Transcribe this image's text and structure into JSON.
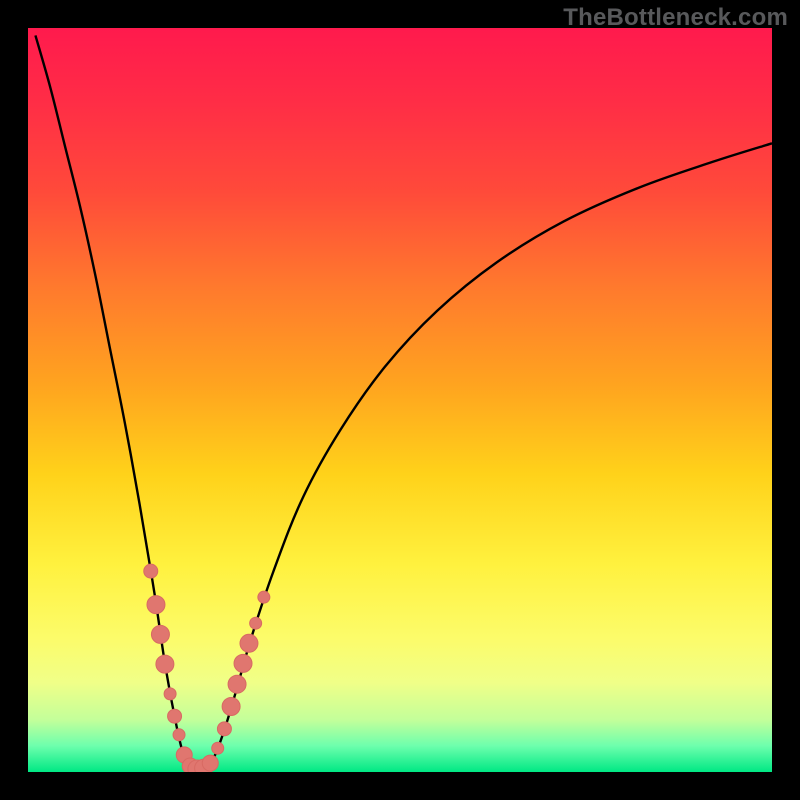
{
  "watermark": "TheBottleneck.com",
  "colors": {
    "frame": "#000000",
    "curve": "#000000",
    "marker_fill": "#e0766f",
    "marker_stroke": "#d86a63",
    "gradient_stops": [
      {
        "offset": 0.0,
        "color": "#ff1a4d"
      },
      {
        "offset": 0.1,
        "color": "#ff2d46"
      },
      {
        "offset": 0.22,
        "color": "#ff4a3a"
      },
      {
        "offset": 0.35,
        "color": "#ff7a2d"
      },
      {
        "offset": 0.48,
        "color": "#ffa41f"
      },
      {
        "offset": 0.6,
        "color": "#ffd21a"
      },
      {
        "offset": 0.72,
        "color": "#fff13e"
      },
      {
        "offset": 0.82,
        "color": "#fcfc6a"
      },
      {
        "offset": 0.88,
        "color": "#f0ff88"
      },
      {
        "offset": 0.93,
        "color": "#c3ff9a"
      },
      {
        "offset": 0.965,
        "color": "#6dffad"
      },
      {
        "offset": 1.0,
        "color": "#00e884"
      }
    ]
  },
  "chart_data": {
    "type": "line",
    "title": "",
    "xlabel": "",
    "ylabel": "",
    "xlim": [
      0,
      100
    ],
    "ylim": [
      0,
      100
    ],
    "grid": false,
    "legend": false,
    "notes": "V-shaped bottleneck curve on red→green vertical gradient. Minimum (~0) at x≈22. Curve value ≈ distance from the optimum; markers are data points clustered near the trough.",
    "curve": [
      {
        "x": 1.0,
        "y": 99.0
      },
      {
        "x": 3.0,
        "y": 92.0
      },
      {
        "x": 5.0,
        "y": 84.0
      },
      {
        "x": 7.0,
        "y": 76.0
      },
      {
        "x": 9.0,
        "y": 67.0
      },
      {
        "x": 11.0,
        "y": 57.0
      },
      {
        "x": 13.0,
        "y": 47.0
      },
      {
        "x": 15.0,
        "y": 36.0
      },
      {
        "x": 17.0,
        "y": 24.0
      },
      {
        "x": 18.5,
        "y": 14.0
      },
      {
        "x": 20.0,
        "y": 6.0
      },
      {
        "x": 21.0,
        "y": 2.0
      },
      {
        "x": 22.0,
        "y": 0.3
      },
      {
        "x": 23.5,
        "y": 0.3
      },
      {
        "x": 25.0,
        "y": 2.0
      },
      {
        "x": 26.5,
        "y": 6.0
      },
      {
        "x": 28.0,
        "y": 11.0
      },
      {
        "x": 30.0,
        "y": 18.0
      },
      {
        "x": 33.0,
        "y": 27.0
      },
      {
        "x": 37.0,
        "y": 37.0
      },
      {
        "x": 42.0,
        "y": 46.0
      },
      {
        "x": 48.0,
        "y": 54.5
      },
      {
        "x": 55.0,
        "y": 62.0
      },
      {
        "x": 63.0,
        "y": 68.5
      },
      {
        "x": 72.0,
        "y": 74.0
      },
      {
        "x": 82.0,
        "y": 78.5
      },
      {
        "x": 92.0,
        "y": 82.0
      },
      {
        "x": 100.0,
        "y": 84.5
      }
    ],
    "markers": [
      {
        "x": 16.5,
        "y": 27.0,
        "r": 7
      },
      {
        "x": 17.2,
        "y": 22.5,
        "r": 9
      },
      {
        "x": 17.8,
        "y": 18.5,
        "r": 9
      },
      {
        "x": 18.4,
        "y": 14.5,
        "r": 9
      },
      {
        "x": 19.1,
        "y": 10.5,
        "r": 6
      },
      {
        "x": 19.7,
        "y": 7.5,
        "r": 7
      },
      {
        "x": 20.3,
        "y": 5.0,
        "r": 6
      },
      {
        "x": 21.0,
        "y": 2.3,
        "r": 8
      },
      {
        "x": 21.8,
        "y": 0.8,
        "r": 8
      },
      {
        "x": 22.7,
        "y": 0.4,
        "r": 9
      },
      {
        "x": 23.6,
        "y": 0.5,
        "r": 9
      },
      {
        "x": 24.5,
        "y": 1.2,
        "r": 8
      },
      {
        "x": 25.5,
        "y": 3.2,
        "r": 6
      },
      {
        "x": 26.4,
        "y": 5.8,
        "r": 7
      },
      {
        "x": 27.3,
        "y": 8.8,
        "r": 9
      },
      {
        "x": 28.1,
        "y": 11.8,
        "r": 9
      },
      {
        "x": 28.9,
        "y": 14.6,
        "r": 9
      },
      {
        "x": 29.7,
        "y": 17.3,
        "r": 9
      },
      {
        "x": 30.6,
        "y": 20.0,
        "r": 6
      },
      {
        "x": 31.7,
        "y": 23.5,
        "r": 6
      }
    ]
  }
}
